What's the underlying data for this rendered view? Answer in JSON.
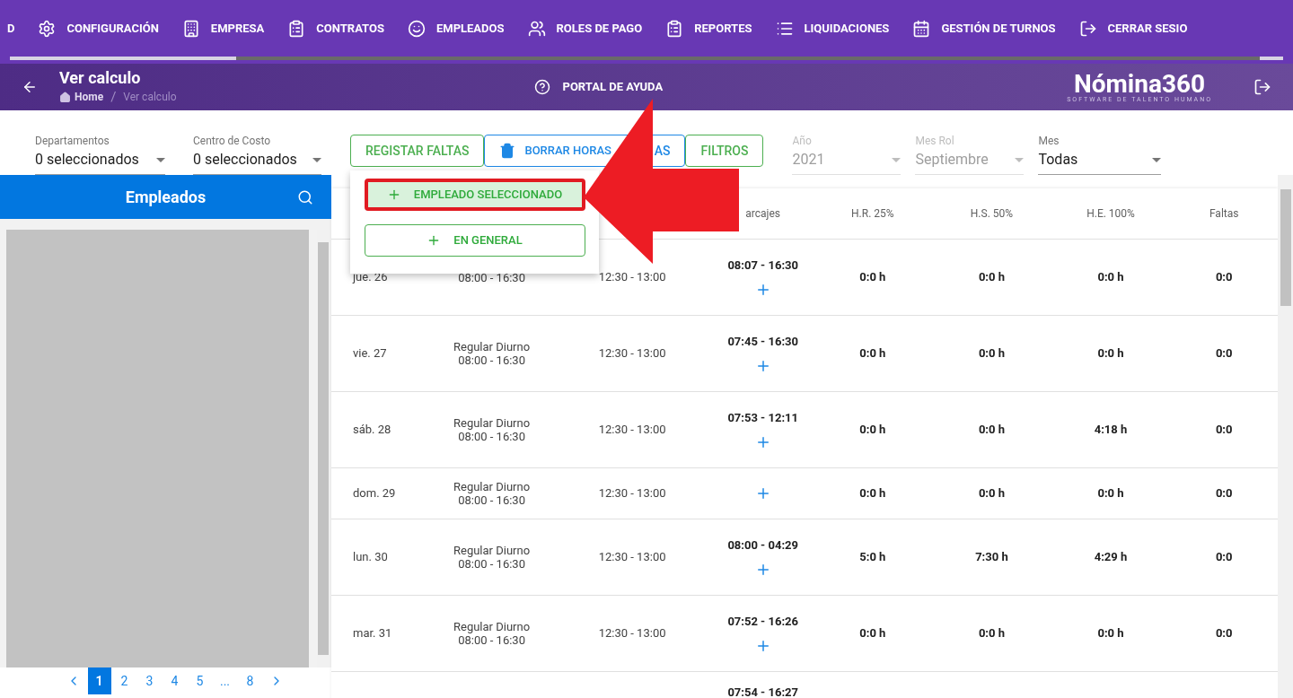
{
  "nav": [
    {
      "kind": "text",
      "label": "D"
    },
    {
      "kind": "gear",
      "label": "CONFIGURACIÓN"
    },
    {
      "kind": "building",
      "label": "EMPRESA"
    },
    {
      "kind": "clipboard",
      "label": "CONTRATOS"
    },
    {
      "kind": "face",
      "label": "EMPLEADOS"
    },
    {
      "kind": "users",
      "label": "ROLES DE PAGO"
    },
    {
      "kind": "clipboard",
      "label": "REPORTES"
    },
    {
      "kind": "list",
      "label": "LIQUIDACIONES"
    },
    {
      "kind": "calendar",
      "label": "GESTIÓN DE TURNOS"
    },
    {
      "kind": "logout",
      "label": "CERRAR SESIO"
    }
  ],
  "header": {
    "title": "Ver calculo",
    "breadcrumb": [
      "Home",
      "/",
      "Ver calculo"
    ],
    "help": "PORTAL DE AYUDA",
    "logo": "Nómina360",
    "logo_tagline": "SOFTWARE DE TALENTO HUMANO"
  },
  "filters": [
    {
      "label": "Departamentos",
      "value": "0 seleccionados",
      "disabled": false
    },
    {
      "label": "Centro de Costo",
      "value": "0 seleccionados",
      "disabled": false
    }
  ],
  "actions": {
    "register": "REGISTAR FALTAS",
    "delete_visible": "BORRAR HORAS",
    "delete_tail": "AS",
    "filters": "FILTROS"
  },
  "period": [
    {
      "label": "Año",
      "value": "2021",
      "disabled": true
    },
    {
      "label": "Mes Rol",
      "value": "Septiembre",
      "disabled": true
    },
    {
      "label": "Mes",
      "value": "Todas",
      "disabled": false
    }
  ],
  "menu": [
    {
      "label": "EMPLEADO SELECCIONADO",
      "selected": true
    },
    {
      "label": "EN GENERAL",
      "selected": false
    }
  ],
  "employees": {
    "title": "Empleados",
    "pages": [
      {
        "label": "1",
        "selected": true
      },
      {
        "label": "2",
        "selected": false
      },
      {
        "label": "3",
        "selected": false
      },
      {
        "label": "4",
        "selected": false
      },
      {
        "label": "5",
        "selected": false
      },
      {
        "label": "...",
        "selected": false
      },
      {
        "label": "8",
        "selected": false
      }
    ]
  },
  "table": {
    "columns": [
      "arcajes",
      "H.R. 25%",
      "H.S. 50%",
      "H.E. 100%",
      "Faltas"
    ],
    "rows": [
      {
        "day": "jue. 26",
        "shift_time": "08:00 - 16:30",
        "break": "12:30 - 13:00",
        "marks": "08:07 - 16:30",
        "hr": "0:0 h",
        "hs": "0:0 h",
        "he": "0:0 h",
        "faltas": "0:0"
      },
      {
        "day": "vie. 27",
        "shift": "Regular Diurno",
        "shift_time": "08:00 - 16:30",
        "break": "12:30 - 13:00",
        "marks": "07:45 - 16:30",
        "hr": "0:0 h",
        "hs": "0:0 h",
        "he": "0:0 h",
        "faltas": "0:0"
      },
      {
        "day": "sáb. 28",
        "shift": "Regular Diurno",
        "shift_time": "08:00 - 16:30",
        "break": "12:30 - 13:00",
        "marks": "07:53 - 12:11",
        "hr": "0:0 h",
        "hs": "0:0 h",
        "he": "4:18 h",
        "faltas": "0:0"
      },
      {
        "day": "dom. 29",
        "shift": "Regular Diurno",
        "shift_time": "08:00 - 16:30",
        "break": "12:30 - 13:00",
        "hr": "0:0 h",
        "hs": "0:0 h",
        "he": "0:0 h",
        "faltas": "0:0"
      },
      {
        "day": "lun. 30",
        "shift": "Regular Diurno",
        "shift_time": "08:00 - 16:30",
        "break": "12:30 - 13:00",
        "marks": "08:00 - 04:29",
        "hr": "5:0 h",
        "hs": "7:30 h",
        "he": "4:29 h",
        "faltas": "0:0"
      },
      {
        "day": "mar. 31",
        "shift": "Regular Diurno",
        "shift_time": "08:00 - 16:30",
        "break": "12:30 - 13:00",
        "marks": "07:52 - 16:26",
        "hr": "0:0 h",
        "hs": "0:0 h",
        "he": "0:0 h",
        "faltas": "0:0"
      },
      {
        "marks": "07:54 - 16:27"
      }
    ]
  }
}
